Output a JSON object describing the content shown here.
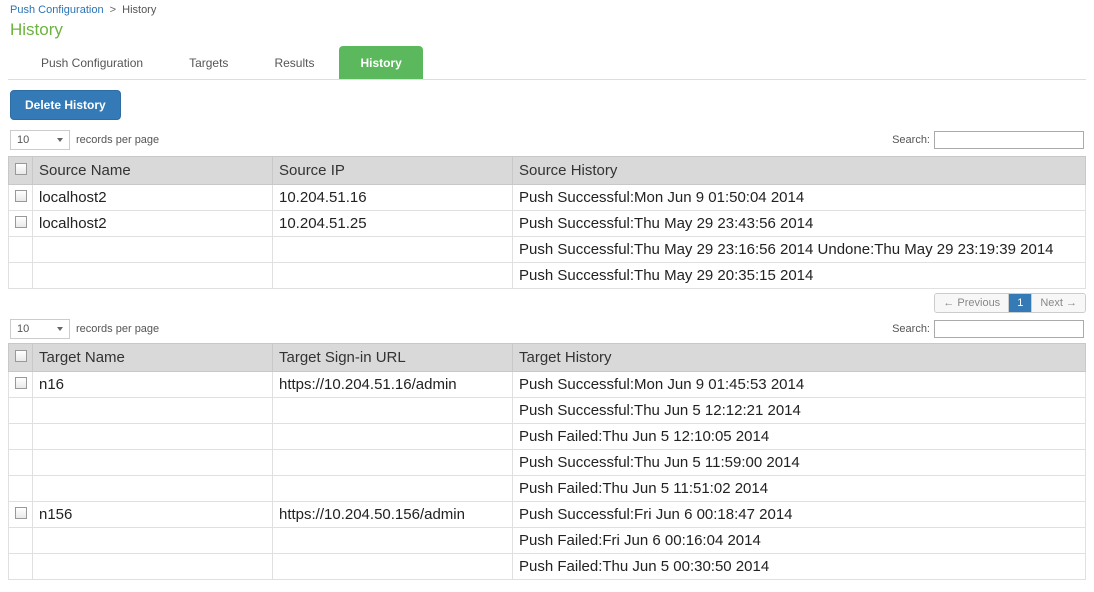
{
  "breadcrumb": {
    "root": "Push Configuration",
    "current": "History"
  },
  "page_title": "History",
  "tabs": {
    "items": [
      "Push Configuration",
      "Targets",
      "Results",
      "History"
    ],
    "active_index": 3
  },
  "toolbar": {
    "delete_label": "Delete History"
  },
  "records_label": "records per page",
  "search_label": "Search:",
  "page_len1": "10",
  "page_len2": "10",
  "pagination": {
    "prev": "← Previous",
    "page": "1",
    "next": "Next →"
  },
  "source_table": {
    "headers": {
      "name": "Source Name",
      "ip": "Source IP",
      "history": "Source History"
    },
    "rows": [
      {
        "name": "localhost2",
        "ip": "10.204.51.16",
        "history": "Push Successful:Mon Jun 9 01:50:04 2014",
        "has_check": true
      },
      {
        "name": "localhost2",
        "ip": "10.204.51.25",
        "history": "Push Successful:Thu May 29 23:43:56 2014",
        "has_check": true
      },
      {
        "name": "",
        "ip": "",
        "history": "Push Successful:Thu May 29 23:16:56 2014 Undone:Thu May 29 23:19:39 2014",
        "has_check": false
      },
      {
        "name": "",
        "ip": "",
        "history": "Push Successful:Thu May 29 20:35:15 2014",
        "has_check": false
      }
    ]
  },
  "target_table": {
    "headers": {
      "name": "Target Name",
      "url": "Target Sign-in URL",
      "history": "Target History"
    },
    "rows": [
      {
        "name": "n16",
        "url": "https://10.204.51.16/admin",
        "history": "Push Successful:Mon Jun 9 01:45:53 2014",
        "has_check": true
      },
      {
        "name": "",
        "url": "",
        "history": "Push Successful:Thu Jun 5 12:12:21 2014",
        "has_check": false
      },
      {
        "name": "",
        "url": "",
        "history": "Push Failed:Thu Jun 5 12:10:05 2014",
        "has_check": false
      },
      {
        "name": "",
        "url": "",
        "history": "Push Successful:Thu Jun 5 11:59:00 2014",
        "has_check": false
      },
      {
        "name": "",
        "url": "",
        "history": "Push Failed:Thu Jun 5 11:51:02 2014",
        "has_check": false
      },
      {
        "name": "n156",
        "url": "https://10.204.50.156/admin",
        "history": "Push Successful:Fri Jun 6 00:18:47 2014",
        "has_check": true
      },
      {
        "name": "",
        "url": "",
        "history": "Push Failed:Fri Jun 6 00:16:04 2014",
        "has_check": false
      },
      {
        "name": "",
        "url": "",
        "history": "Push Failed:Thu Jun 5 00:30:50 2014",
        "has_check": false
      }
    ]
  }
}
